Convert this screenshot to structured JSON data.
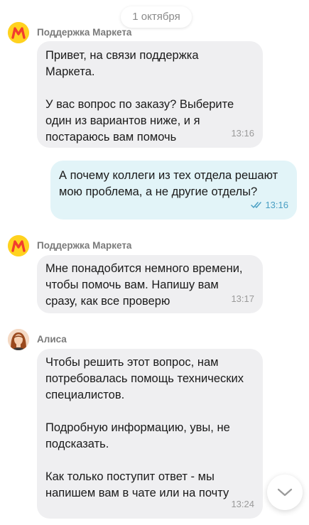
{
  "date_label": "1 октября",
  "messages": [
    {
      "sender": "Поддержка Маркета",
      "text": "Привет, на связи поддержка\nМаркета.\n\nУ вас вопрос по заказу? Выберите\nодин из вариантов ниже, и я\nпостараюсь вам помочь",
      "time": "13:16"
    },
    {
      "text": "А почему коллеги из тех отдела решают\nмою проблема, а не другие отделы?",
      "time": "13:16"
    },
    {
      "sender": "Поддержка Маркета",
      "text": "Мне понадобится немного времени,\nчтобы помочь вам. Напишу вам\nсразу, как все проверю",
      "time": "13:17"
    },
    {
      "sender": "Алиса",
      "text": "Чтобы решить этот вопрос, нам\nпотребовалась помощь технических\nспециалистов.\n\nПодробную информацию, увы, не\nподсказать.\n\nКак только поступит ответ - мы\nнапишем вам в чате или на почту",
      "time": "13:24"
    }
  ],
  "icons": {
    "market_avatar": "market-logo-icon",
    "alice_avatar": "user-avatar",
    "read_status": "double-check-icon",
    "scroll_down": "chevron-down-icon"
  },
  "colors": {
    "incoming_bubble": "#efeff1",
    "outgoing_bubble": "#e2f4f8",
    "market_brand": "#ffd21f",
    "market_accent": "#f23d2e",
    "read_check": "#4a9fc3"
  }
}
